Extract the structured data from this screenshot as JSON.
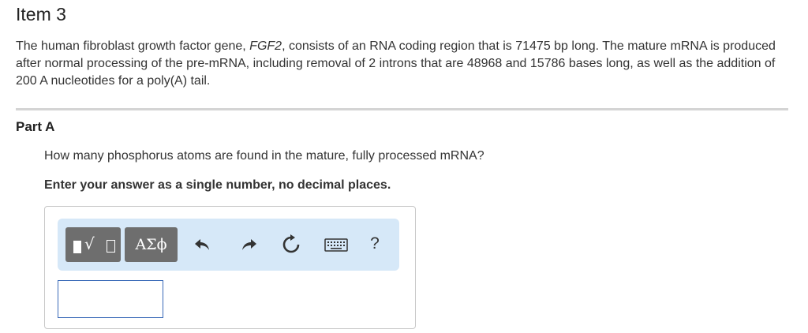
{
  "item": {
    "title": "Item 3"
  },
  "problem": {
    "text_before": "The human fibroblast growth factor gene, ",
    "gene": "FGF2",
    "text_after": ", consists of an RNA coding region that is 71475 bp long.  The mature mRNA is produced after normal processing of the pre-mRNA, including removal of 2 introns that are 48968 and 15786 bases long, as well as the addition of 200 A nucleotides for a poly(A) tail."
  },
  "part": {
    "title": "Part A",
    "question": "How many phosphorus atoms are found in the mature, fully processed mRNA?",
    "instruction": "Enter your answer as a single number, no decimal places."
  },
  "toolbar": {
    "symbols_label": "ΑΣϕ",
    "help_label": "?",
    "icons": {
      "templates": "templates-icon",
      "undo": "undo-icon",
      "redo": "redo-icon",
      "reset": "reset-icon",
      "keyboard": "keyboard-icon"
    },
    "colors": {
      "toolbar_bg": "#d6e8f8",
      "button_bg": "#6e6e6e",
      "input_border": "#3a6ab8"
    }
  },
  "answer": {
    "value": ""
  }
}
